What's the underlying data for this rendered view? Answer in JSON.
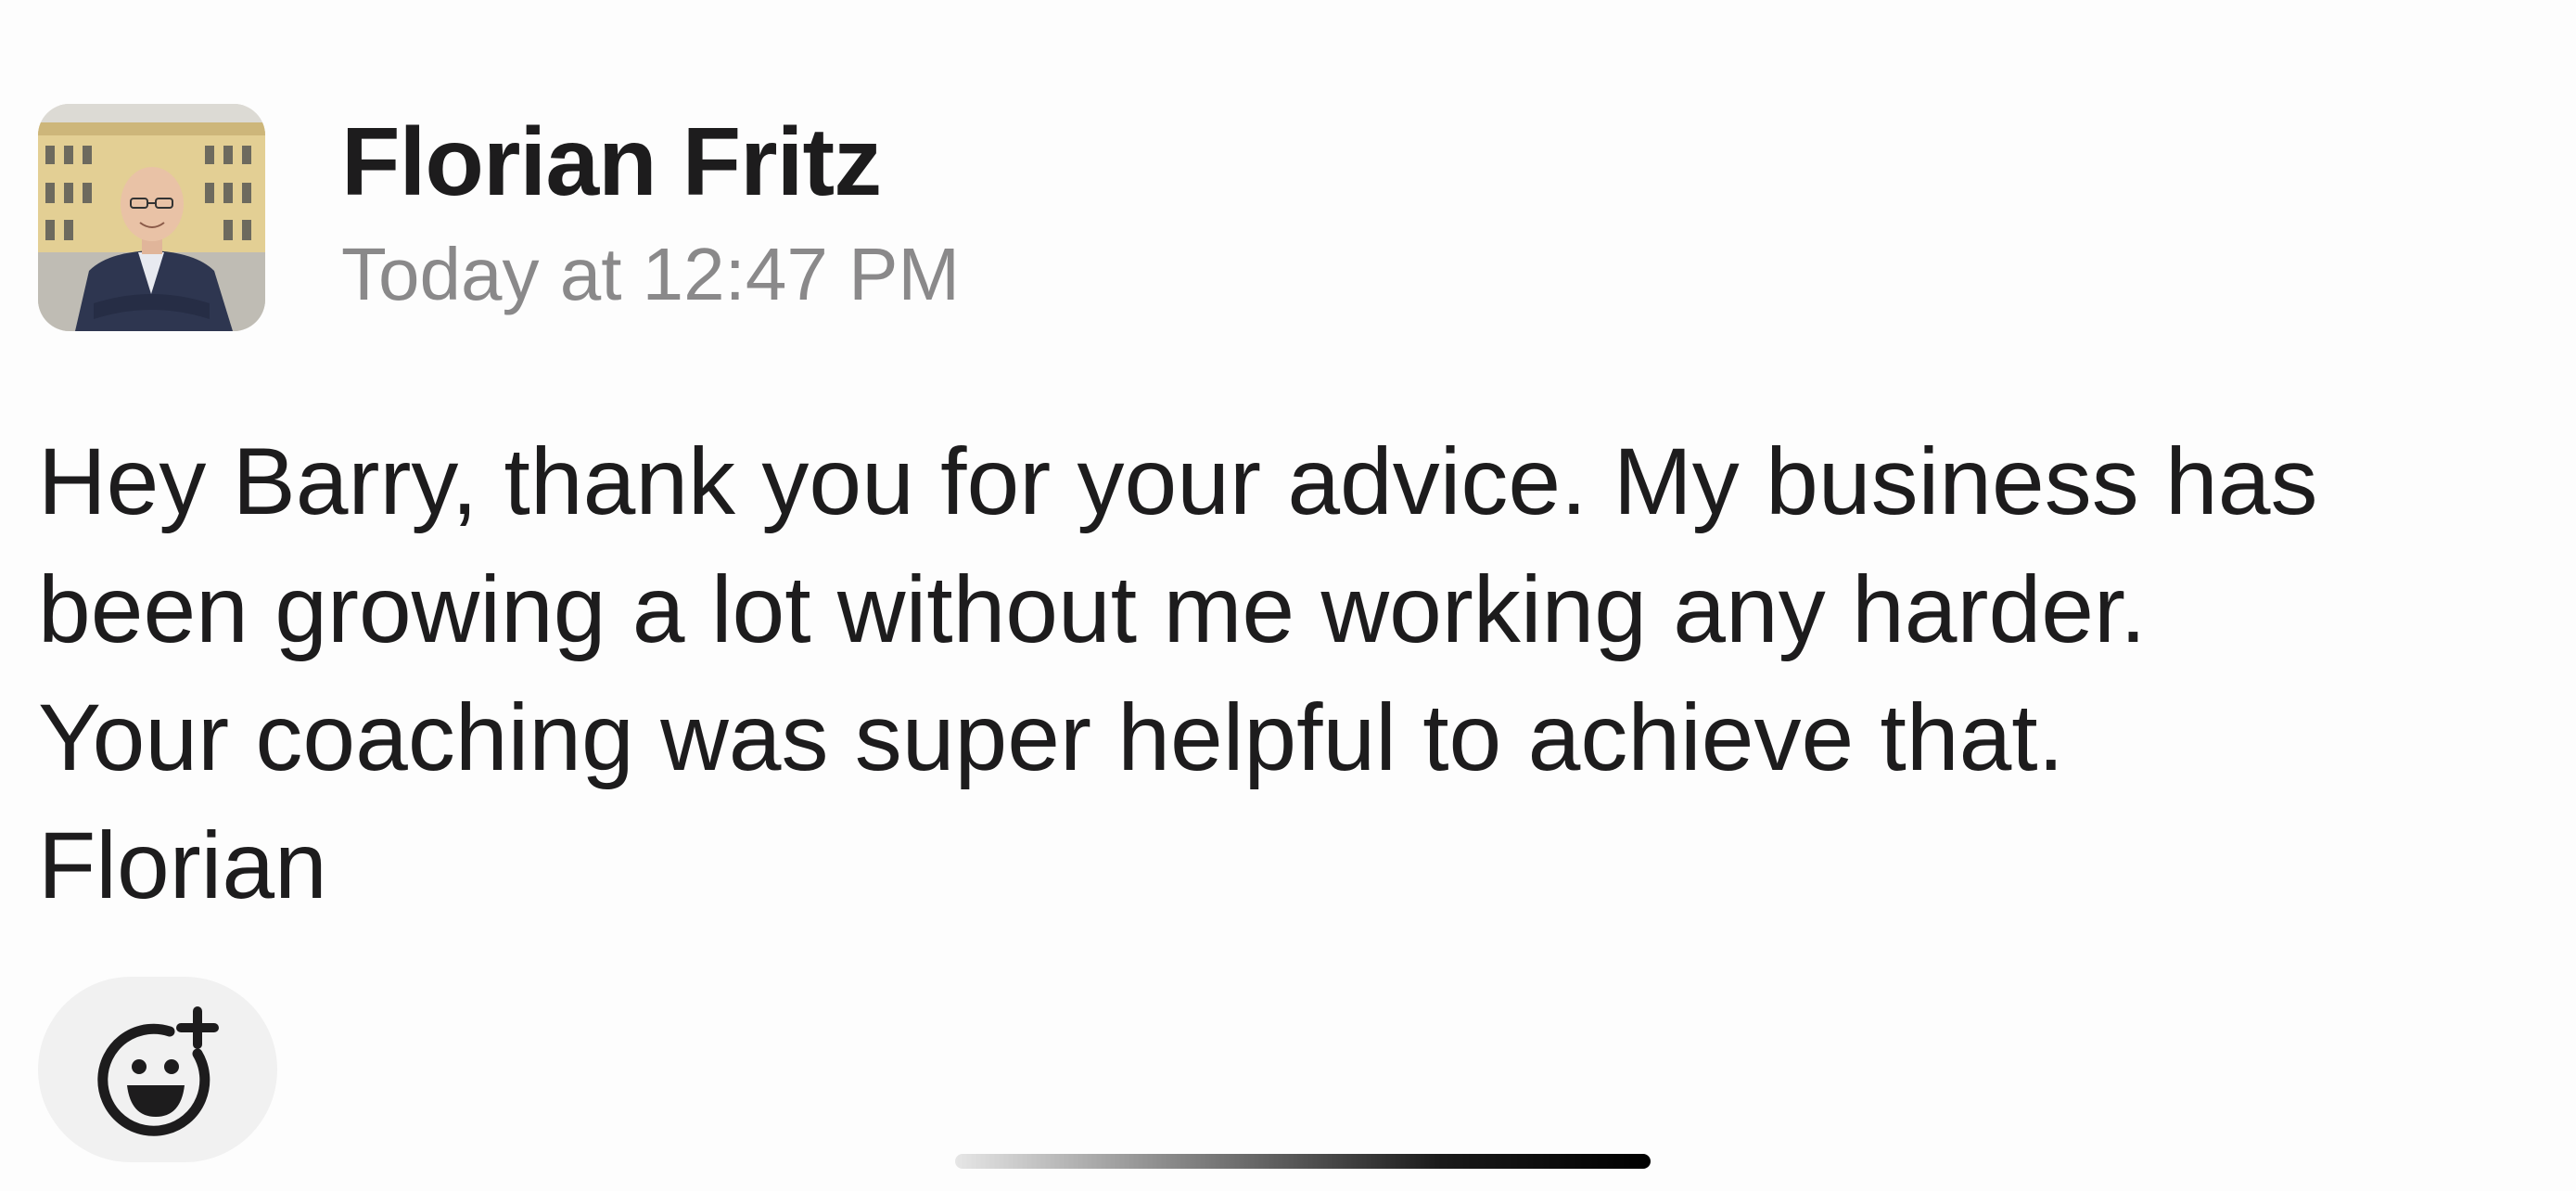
{
  "message": {
    "sender": {
      "name": "Florian Fritz",
      "avatar_icon": "person-photo"
    },
    "timestamp": "Today at 12:47 PM",
    "body_lines": [
      "Hey Barry, thank you for your advice. My business has",
      "been growing a lot without me working any harder.",
      "Your coaching was super helpful to achieve that.",
      "Florian"
    ]
  },
  "reactions": {
    "add_reaction_icon": "emoji-add-icon"
  },
  "colors": {
    "background": "#fdfdfd",
    "text_primary": "#1d1c1d",
    "text_secondary": "#8a898a",
    "reaction_bg": "#f1f1f1"
  }
}
